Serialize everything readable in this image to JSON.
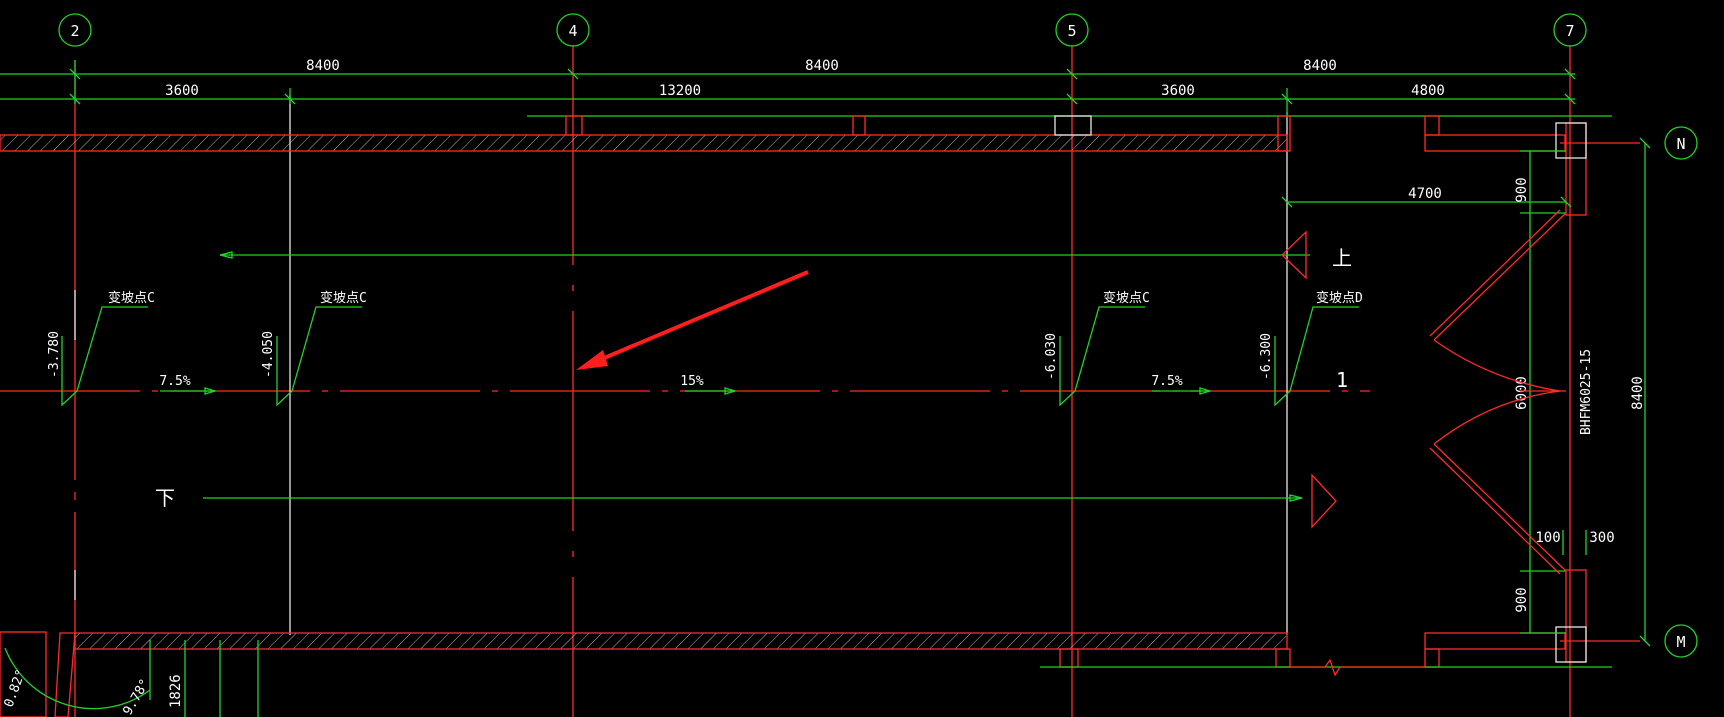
{
  "axes": {
    "col_2": "2",
    "col_4": "4",
    "col_5": "5",
    "col_7": "7",
    "row_n": "N",
    "row_m": "M"
  },
  "dimensions": {
    "top_8400_a": "8400",
    "top_8400_b": "8400",
    "top_8400_c": "8400",
    "sub_3600_a": "3600",
    "sub_13200": "13200",
    "sub_3600_b": "3600",
    "sub_4800": "4800",
    "width_4700": "4700",
    "v_900_top": "900",
    "v_6000": "6000",
    "v_900_bot": "900",
    "v_8400": "8400",
    "h_100": "100",
    "h_300": "300",
    "v_1826": "1826"
  },
  "ramp": {
    "change_point_c1": "变坡点C",
    "change_point_c2": "变坡点C",
    "change_point_c3": "变坡点C",
    "change_point_d": "变坡点D",
    "elev_1": "-3.780",
    "elev_2": "-4.050",
    "elev_3": "-6.030",
    "elev_4": "-6.300",
    "slope_1": "7.5%",
    "slope_2": "15%",
    "slope_3": "7.5%",
    "up": "上",
    "down": "下",
    "ramp_number": "1"
  },
  "door_tag": "BHFM6025-15",
  "partial_labels": {
    "angle_1": "0.82°",
    "angle_2": "9.78°"
  },
  "colors": {
    "background": "#000000",
    "dimension_lines": "#22d12b",
    "walls_axes": "#ff2a2a",
    "text": "#ffffff",
    "annotation_arrow": "#ff1e1e"
  }
}
